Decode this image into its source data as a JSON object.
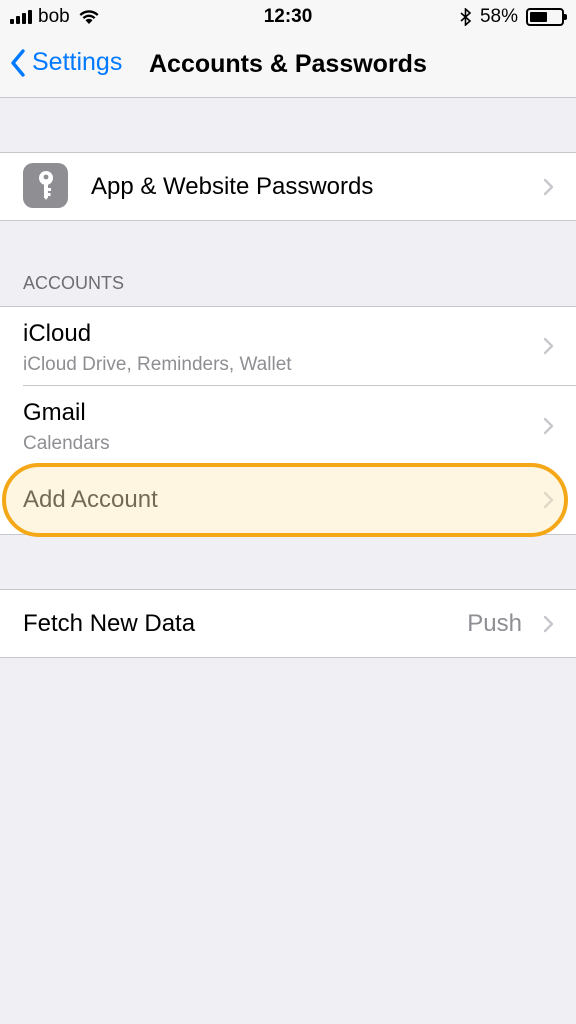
{
  "status_bar": {
    "carrier": "bob",
    "time": "12:30",
    "battery_percent": "58%",
    "battery_level": 0.58
  },
  "nav": {
    "back_label": "Settings",
    "title": "Accounts & Passwords"
  },
  "passwords_row": {
    "label": "App & Website Passwords",
    "icon": "key-icon"
  },
  "accounts_section": {
    "header": "ACCOUNTS",
    "items": [
      {
        "title": "iCloud",
        "subtitle": "iCloud Drive, Reminders, Wallet"
      },
      {
        "title": "Gmail",
        "subtitle": "Calendars"
      }
    ],
    "add_label": "Add Account"
  },
  "fetch_row": {
    "label": "Fetch New Data",
    "value": "Push"
  },
  "colors": {
    "accent": "#007aff",
    "highlight": "#f4a817",
    "background": "#efeff4"
  }
}
